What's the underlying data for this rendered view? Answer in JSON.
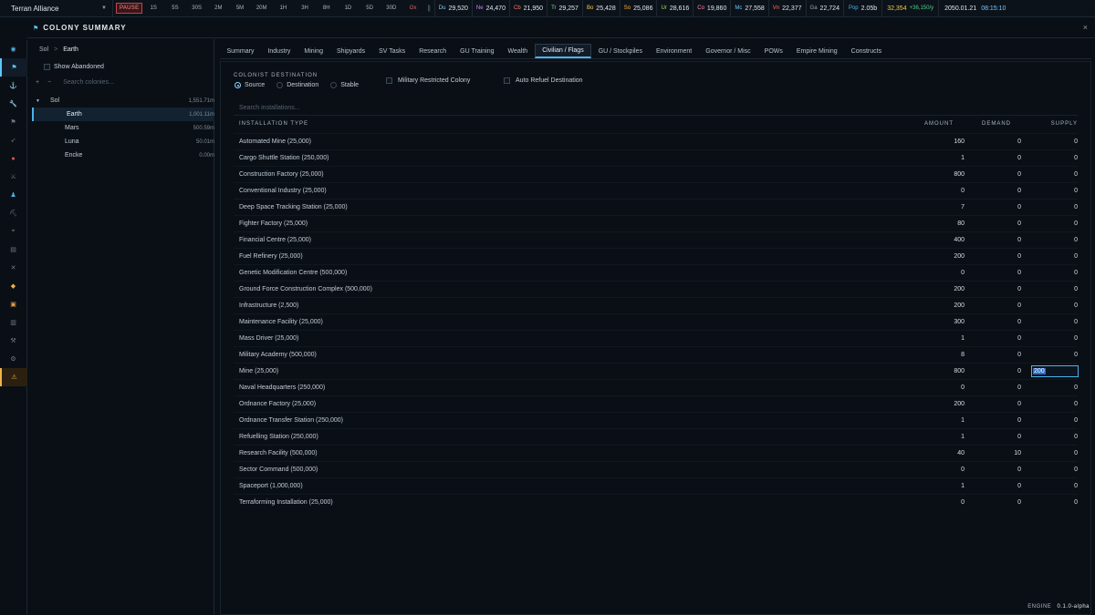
{
  "topbar": {
    "empire": "Terran Alliance",
    "pause": "PAUSE",
    "speeds": [
      "1S",
      "5S",
      "30S",
      "2M",
      "5M",
      "20M",
      "1H",
      "3H",
      "8H",
      "1D",
      "5D",
      "30D"
    ],
    "ox": "Ox",
    "minerals": [
      {
        "ab": "Du",
        "val": "29,520",
        "color": "#7fd0ff"
      },
      {
        "ab": "Ne",
        "val": "24,470",
        "color": "#c08cff"
      },
      {
        "ab": "Cb",
        "val": "21,950",
        "color": "#ff7b6b"
      },
      {
        "ab": "Tr",
        "val": "29,257",
        "color": "#73e0a0"
      },
      {
        "ab": "Bo",
        "val": "25,428",
        "color": "#ffd05c"
      },
      {
        "ab": "So",
        "val": "25,086",
        "color": "#ffb347"
      },
      {
        "ab": "Ur",
        "val": "28,616",
        "color": "#9be36b"
      },
      {
        "ab": "Co",
        "val": "19,860",
        "color": "#ff8cb0"
      },
      {
        "ab": "Mc",
        "val": "27,558",
        "color": "#6fc7ff"
      },
      {
        "ab": "Vn",
        "val": "22,377",
        "color": "#ff6f6f"
      },
      {
        "ab": "Ga",
        "val": "22,724",
        "color": "#9aa7b4"
      }
    ],
    "pop_label": "Pop",
    "pop_val": "2.05b",
    "wealth": "32,354",
    "wealth_rate": "+36,150/y",
    "date": "2050.01.21",
    "time": "08:15:10"
  },
  "sidebar_icons": [
    "pin-icon",
    "flag-icon",
    "anchor-icon",
    "wrench-icon",
    "flag-small-icon",
    "rocket-icon",
    "planet-icon",
    "swords-icon",
    "person-icon",
    "pickaxe-icon",
    "telescope-icon",
    "clipboard-icon",
    "cross-swords-icon",
    "tag-icon",
    "box-icon",
    "document-icon",
    "tools-icon",
    "gear-icon",
    "warning-icon"
  ],
  "window": {
    "title": "COLONY SUMMARY",
    "close": "×"
  },
  "left": {
    "crumb_system": "Sol",
    "crumb_sep": ">",
    "crumb_body": "Earth",
    "show_abandoned": "Show Abandoned",
    "add": "+",
    "remove": "−",
    "search_placeholder": "Search colonies...",
    "tree": [
      {
        "name": "Sol",
        "pop": "1,551.71m",
        "type": "sys"
      },
      {
        "name": "Earth",
        "pop": "1,001.11m",
        "type": "col",
        "selected": true
      },
      {
        "name": "Mars",
        "pop": "500.59m",
        "type": "col"
      },
      {
        "name": "Luna",
        "pop": "50.01m",
        "type": "col"
      },
      {
        "name": "Encke",
        "pop": "0.00m",
        "type": "col"
      }
    ]
  },
  "tabs": [
    "Summary",
    "Industry",
    "Mining",
    "Shipyards",
    "SV Tasks",
    "Research",
    "GU Training",
    "Wealth",
    "Civilian / Flags",
    "GU / Stockpiles",
    "Environment",
    "Governor / Misc",
    "POWs",
    "Empire Mining",
    "Constructs"
  ],
  "active_tab": 8,
  "civilian": {
    "colonist_destination_label": "COLONIST DESTINATION",
    "options": [
      "Source",
      "Destination",
      "Stable"
    ],
    "selected_option": 0,
    "military_restricted": "Military Restricted Colony",
    "auto_refuel": "Auto Refuel Destination",
    "search_placeholder": "Search installations...",
    "headers": {
      "type": "INSTALLATION TYPE",
      "amount": "AMOUNT",
      "demand": "DEMAND",
      "supply": "SUPPLY"
    },
    "rows": [
      {
        "name": "Automated Mine (25,000)",
        "amount": "160",
        "demand": "0",
        "supply": "0"
      },
      {
        "name": "Cargo Shuttle Station (250,000)",
        "amount": "1",
        "demand": "0",
        "supply": "0"
      },
      {
        "name": "Construction Factory (25,000)",
        "amount": "800",
        "demand": "0",
        "supply": "0"
      },
      {
        "name": "Conventional Industry (25,000)",
        "amount": "0",
        "demand": "0",
        "supply": "0"
      },
      {
        "name": "Deep Space Tracking Station (25,000)",
        "amount": "7",
        "demand": "0",
        "supply": "0"
      },
      {
        "name": "Fighter Factory (25,000)",
        "amount": "80",
        "demand": "0",
        "supply": "0"
      },
      {
        "name": "Financial Centre (25,000)",
        "amount": "400",
        "demand": "0",
        "supply": "0"
      },
      {
        "name": "Fuel Refinery (25,000)",
        "amount": "200",
        "demand": "0",
        "supply": "0"
      },
      {
        "name": "Genetic Modification Centre (500,000)",
        "amount": "0",
        "demand": "0",
        "supply": "0"
      },
      {
        "name": "Ground Force Construction Complex (500,000)",
        "amount": "200",
        "demand": "0",
        "supply": "0"
      },
      {
        "name": "Infrastructure (2,500)",
        "amount": "200",
        "demand": "0",
        "supply": "0"
      },
      {
        "name": "Maintenance Facility (25,000)",
        "amount": "300",
        "demand": "0",
        "supply": "0"
      },
      {
        "name": "Mass Driver (25,000)",
        "amount": "1",
        "demand": "0",
        "supply": "0"
      },
      {
        "name": "Military Academy (500,000)",
        "amount": "8",
        "demand": "0",
        "supply": "0"
      },
      {
        "name": "Mine (25,000)",
        "amount": "800",
        "demand": "0",
        "supply": "200",
        "editing": true
      },
      {
        "name": "Naval Headquarters (250,000)",
        "amount": "0",
        "demand": "0",
        "supply": "0"
      },
      {
        "name": "Ordnance Factory (25,000)",
        "amount": "200",
        "demand": "0",
        "supply": "0"
      },
      {
        "name": "Ordnance Transfer Station (250,000)",
        "amount": "1",
        "demand": "0",
        "supply": "0"
      },
      {
        "name": "Refuelling Station (250,000)",
        "amount": "1",
        "demand": "0",
        "supply": "0"
      },
      {
        "name": "Research Facility (500,000)",
        "amount": "40",
        "demand": "10",
        "supply": "0"
      },
      {
        "name": "Sector Command (500,000)",
        "amount": "0",
        "demand": "0",
        "supply": "0"
      },
      {
        "name": "Spaceport (1,000,000)",
        "amount": "1",
        "demand": "0",
        "supply": "0"
      },
      {
        "name": "Terraforming Installation (25,000)",
        "amount": "0",
        "demand": "0",
        "supply": "0"
      }
    ]
  },
  "footer": {
    "engine": "ENGINE",
    "version": "0.1.0-alpha"
  }
}
